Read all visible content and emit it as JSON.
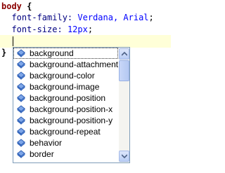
{
  "editor": {
    "line1": {
      "selector": "body",
      "open_brace": "{"
    },
    "line2": {
      "property": "font-family:",
      "value": "Verdana, Arial",
      "end": ";"
    },
    "line3": {
      "property": "font-size:",
      "value": "12px",
      "end": ";"
    },
    "line5": {
      "close_brace": "}"
    }
  },
  "autocomplete": {
    "icon": "property-icon",
    "selected_index": 0,
    "items": [
      {
        "label": "background"
      },
      {
        "label": "background-attachment"
      },
      {
        "label": "background-color"
      },
      {
        "label": "background-image"
      },
      {
        "label": "background-position"
      },
      {
        "label": "background-position-x"
      },
      {
        "label": "background-position-y"
      },
      {
        "label": "background-repeat"
      },
      {
        "label": "behavior"
      },
      {
        "label": "border"
      }
    ]
  },
  "colors": {
    "selector": "#8b0000",
    "property": "#000080",
    "value": "#0000ff",
    "current_line": "#ffffd8",
    "popup_border": "#7f9db9"
  }
}
